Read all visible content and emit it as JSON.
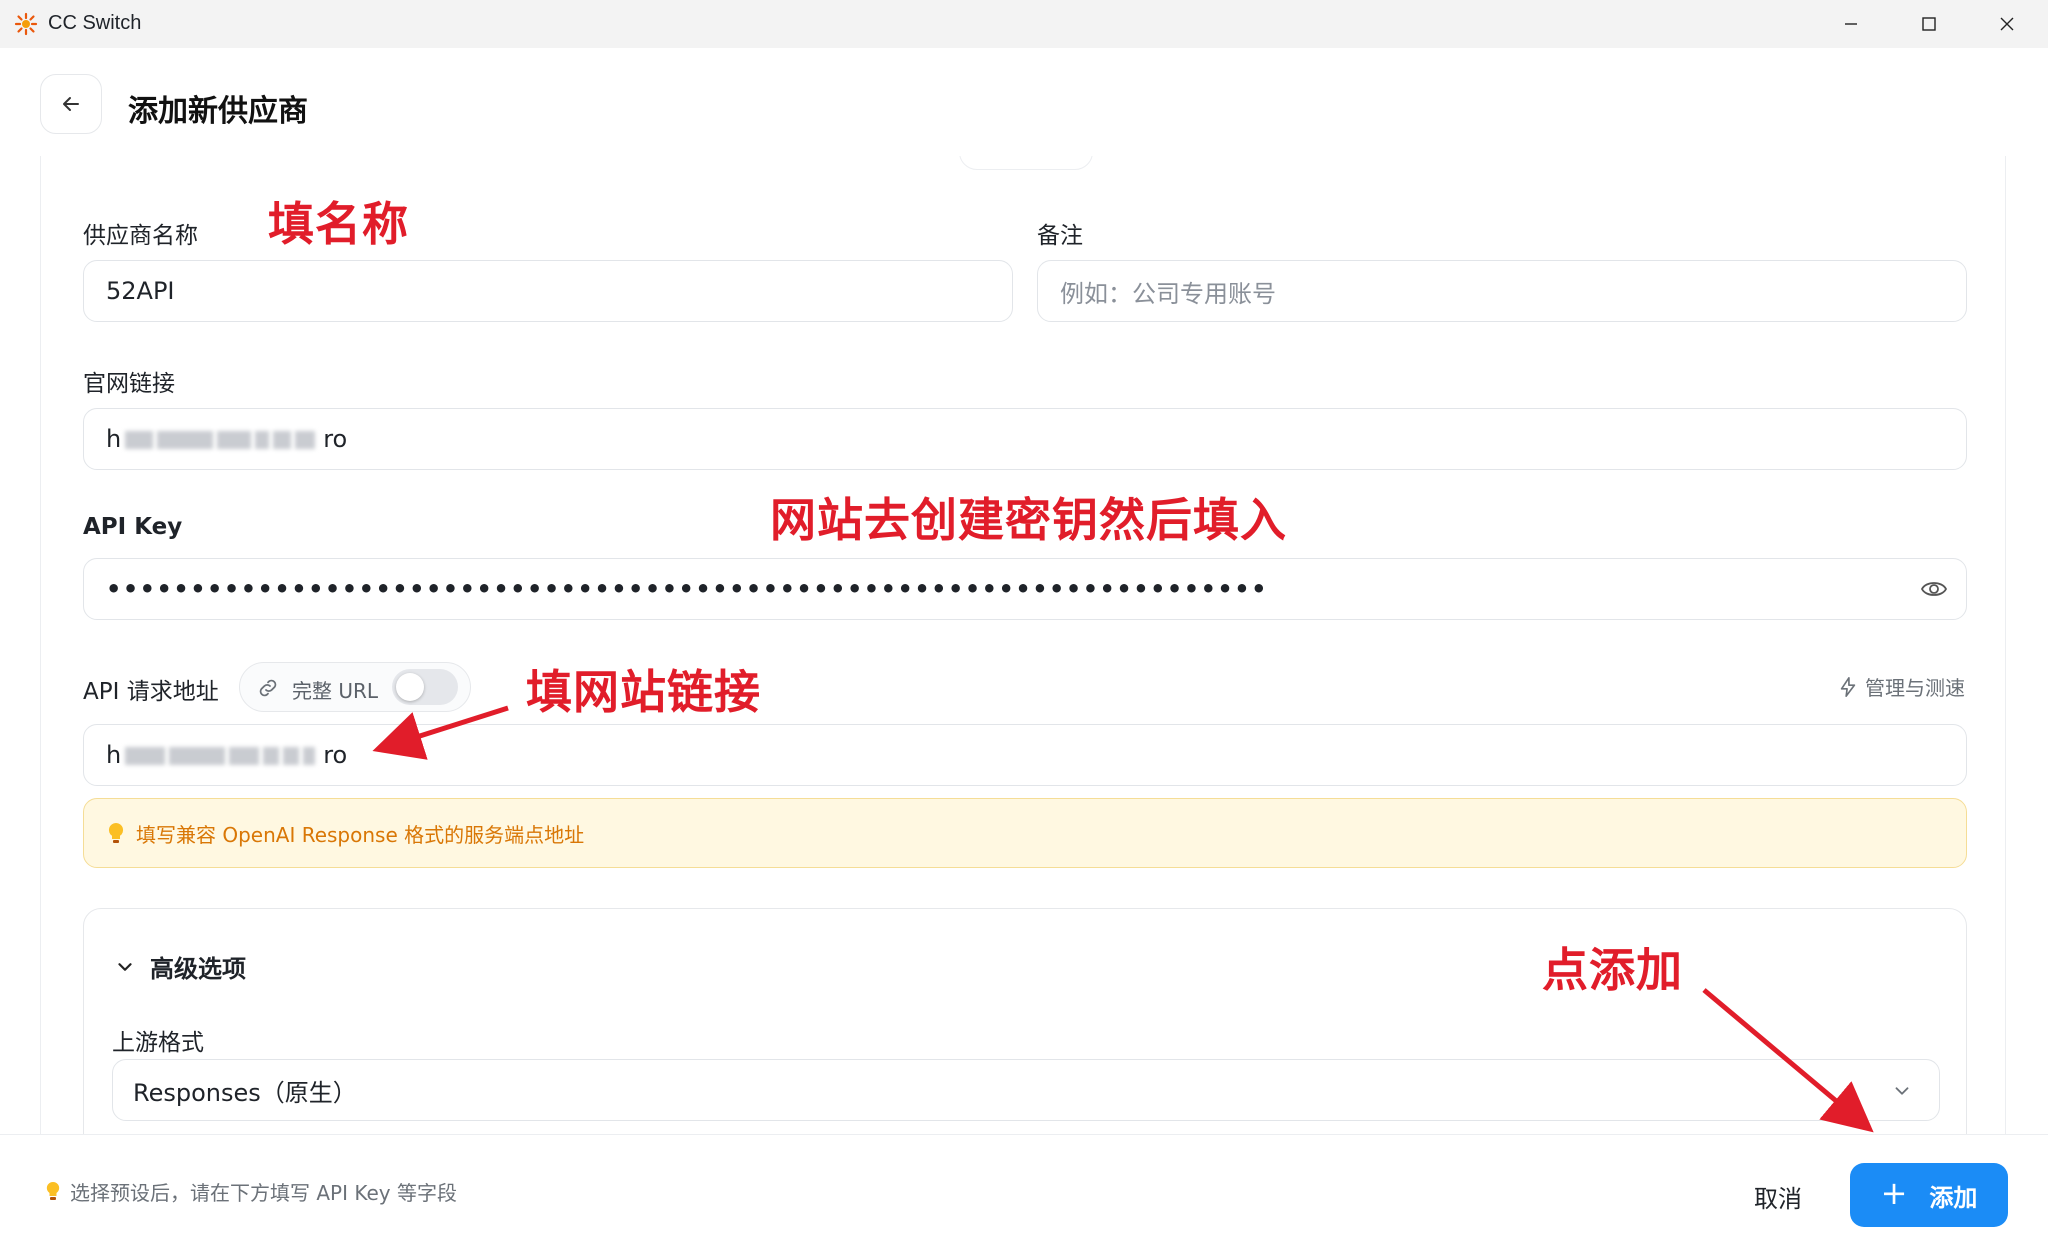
{
  "window": {
    "title": "CC Switch"
  },
  "header": {
    "title": "添加新供应商"
  },
  "form": {
    "name_label": "供应商名称",
    "name_value": "52API",
    "notes_label": "备注",
    "notes_placeholder": "例如：公司专用账号",
    "website_label": "官网链接",
    "website_value_prefix": "h",
    "website_value_suffix": "ro",
    "apikey_label": "API Key",
    "apikey_masked": "•••••••••••••••••••••••••••••••••••••••••••••••••••••••••••••••••••••",
    "endpoint_label": "API 请求地址",
    "full_url_label": "完整 URL",
    "full_url_enabled": false,
    "manage_label": "管理与测速",
    "endpoint_value_prefix": "h",
    "endpoint_value_suffix": "ro",
    "endpoint_hint": "填写兼容 OpenAI Response 格式的服务端点地址"
  },
  "advanced": {
    "title": "高级选项",
    "upstream_label": "上游格式",
    "upstream_value": "Responses（原生）"
  },
  "footer": {
    "hint": "选择预设后，请在下方填写 API Key 等字段",
    "cancel_label": "取消",
    "add_label": "添加"
  },
  "annotations": {
    "fill_name": "填名称",
    "create_key": "网站去创建密钥然后填入",
    "fill_url": "填网站链接",
    "click_add": "点添加"
  },
  "colors": {
    "accent": "#1b8cf6",
    "annotation": "#e11d2a",
    "hint_text": "#d97706",
    "hint_bg": "#fff8e1"
  }
}
